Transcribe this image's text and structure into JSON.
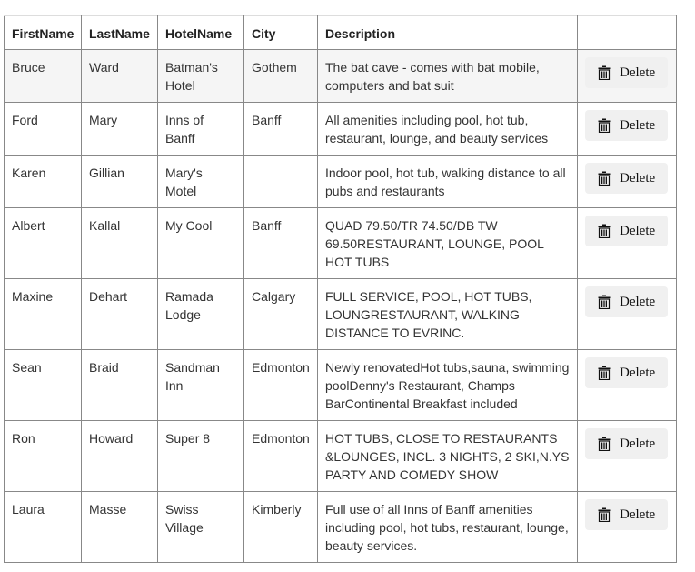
{
  "table": {
    "headers": [
      "FirstName",
      "LastName",
      "HotelName",
      "City",
      "Description",
      ""
    ],
    "delete_label": "Delete",
    "delete_icon": "trash-icon",
    "rows": [
      {
        "first": "Bruce",
        "last": "Ward",
        "hotel": "Batman's Hotel",
        "city": "Gothem",
        "description": "The bat cave - comes with bat mobile, computers and bat suit"
      },
      {
        "first": "Ford",
        "last": "Mary",
        "hotel": "Inns of Banff",
        "city": "Banff",
        "description": "All amenities including pool, hot tub, restaurant, lounge, and beauty services"
      },
      {
        "first": "Karen",
        "last": "Gillian",
        "hotel": "Mary's Motel",
        "city": "",
        "description": "Indoor pool, hot tub, walking distance to all pubs and restaurants"
      },
      {
        "first": "Albert",
        "last": "Kallal",
        "hotel": "My Cool",
        "city": "Banff",
        "description": "QUAD 79.50/TR 74.50/DB TW 69.50RESTAURANT, LOUNGE, POOL HOT TUBS"
      },
      {
        "first": "Maxine",
        "last": "Dehart",
        "hotel": "Ramada Lodge",
        "city": "Calgary",
        "description": "FULL SERVICE, POOL, HOT TUBS, LOUNGRESTAURANT, WALKING DISTANCE TO EVRINC."
      },
      {
        "first": "Sean",
        "last": "Braid",
        "hotel": "Sandman Inn",
        "city": "Edmonton",
        "description": "Newly renovatedHot tubs,sauna, swimming poolDenny's Restaurant, Champs BarContinental Breakfast included"
      },
      {
        "first": "Ron",
        "last": "Howard",
        "hotel": "Super 8",
        "city": "Edmonton",
        "description": "HOT TUBS, CLOSE TO RESTAURANTS &LOUNGES, INCL. 3 NIGHTS, 2 SKI,N.YS PARTY AND COMEDY SHOW"
      },
      {
        "first": "Laura",
        "last": "Masse",
        "hotel": "Swiss Village",
        "city": "Kimberly",
        "description": "Full use of all Inns of Banff amenities including pool, hot tubs, restaurant, lounge, beauty services."
      }
    ]
  }
}
